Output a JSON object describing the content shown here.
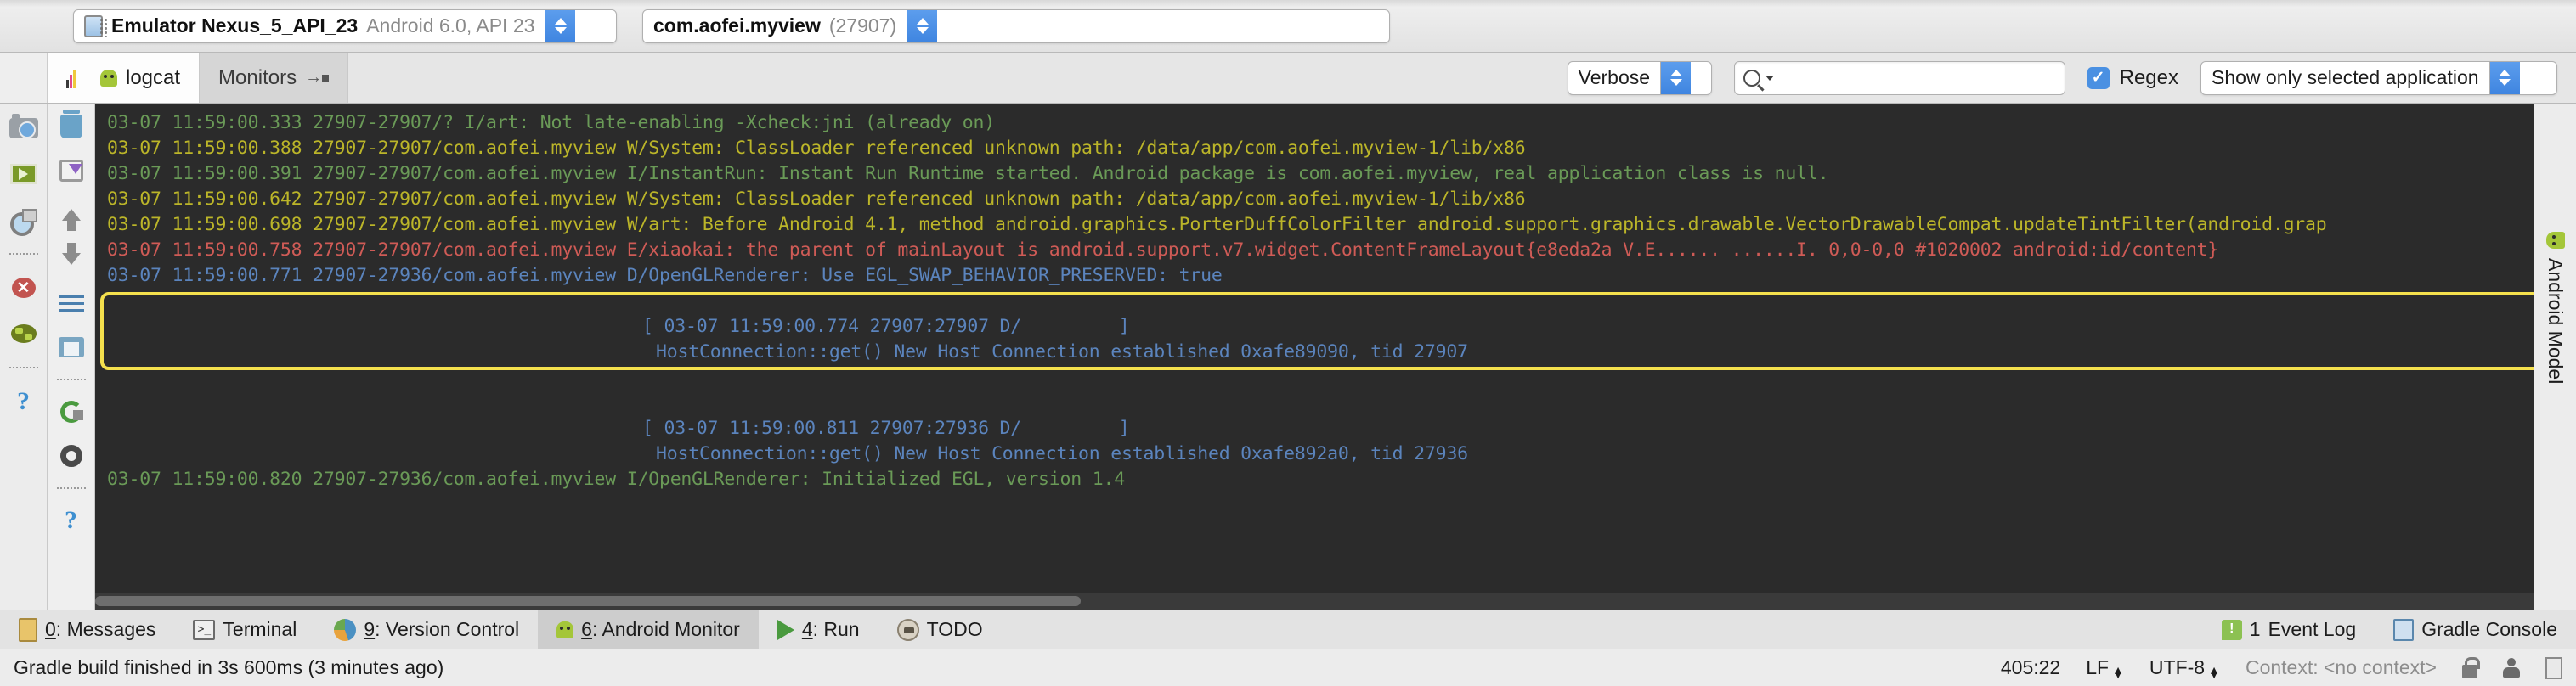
{
  "device_bar": {
    "device_combo": {
      "name": "Emulator Nexus_5_API_23",
      "detail": "Android 6.0, API 23"
    },
    "process_combo": {
      "package": "com.aofei.myview",
      "pid": "(27907)"
    }
  },
  "tabs": [
    {
      "label": "logcat",
      "icon": "logcat-icon",
      "active": true
    },
    {
      "label": "Monitors",
      "icon": "monitors-icon",
      "active": false
    }
  ],
  "log_toolbar": {
    "level": "Verbose",
    "search_placeholder": "",
    "search_value": "",
    "regex_label": "Regex",
    "regex_checked": true,
    "filter": "Show only selected application"
  },
  "sidebar_icons": [
    {
      "name": "screenshot-icon"
    },
    {
      "name": "screen-record-icon"
    },
    {
      "name": "layout-inspector-icon"
    },
    {
      "name": "separator"
    },
    {
      "name": "terminate-application-icon"
    },
    {
      "name": "system-information-icon"
    },
    {
      "name": "separator"
    },
    {
      "name": "help-icon"
    }
  ],
  "log_toolbar_icons": [
    {
      "name": "clear-logcat-icon"
    },
    {
      "name": "scroll-to-end-icon"
    },
    {
      "name": "up-the-stack-trace-icon"
    },
    {
      "name": "down-the-stack-trace-icon"
    },
    {
      "name": "soft-wraps-icon"
    },
    {
      "name": "print-icon"
    },
    {
      "name": "separator"
    },
    {
      "name": "restart-icon"
    },
    {
      "name": "logcat-settings-icon"
    },
    {
      "name": "separator"
    },
    {
      "name": "help-icon"
    }
  ],
  "console": {
    "highlight_color": "#f4e04d",
    "lines": [
      {
        "text": "03-07 11:59:00.333 27907-27907/? I/art: Not late-enabling -Xcheck:jni (already on)",
        "color": "green",
        "indent": 0
      },
      {
        "text": "03-07 11:59:00.388 27907-27907/com.aofei.myview W/System: ClassLoader referenced unknown path: /data/app/com.aofei.myview-1/lib/x86",
        "color": "yellow",
        "indent": 0
      },
      {
        "text": "03-07 11:59:00.391 27907-27907/com.aofei.myview I/InstantRun: Instant Run Runtime started. Android package is com.aofei.myview, real application class is null.",
        "color": "green",
        "indent": 0
      },
      {
        "text": "03-07 11:59:00.642 27907-27907/com.aofei.myview W/System: ClassLoader referenced unknown path: /data/app/com.aofei.myview-1/lib/x86",
        "color": "yellow",
        "indent": 0
      },
      {
        "text": "03-07 11:59:00.698 27907-27907/com.aofei.myview W/art: Before Android 4.1, method android.graphics.PorterDuffColorFilter android.support.graphics.drawable.VectorDrawableCompat.updateTintFilter(android.grap",
        "color": "yellow",
        "indent": 0
      },
      {
        "text": "03-07 11:59:00.758 27907-27907/com.aofei.myview E/xiaokai: the parent of mainLayout is android.support.v7.widget.ContentFrameLayout{e8eda2a V.E...... ......I. 0,0-0,0 #1020002 android:id/content}",
        "color": "red",
        "indent": 0
      },
      {
        "text": "03-07 11:59:00.771 27907-27936/com.aofei.myview D/OpenGLRenderer: Use EGL_SWAP_BEHAVIOR_PRESERVED: true",
        "color": "blue",
        "indent": 0
      },
      {
        "text": "",
        "color": "blue",
        "indent": 0
      },
      {
        "text": "[ 03-07 11:59:00.774 27907:27907 D/         ]",
        "color": "blue",
        "indent": 2
      },
      {
        "text": "HostConnection::get() New Host Connection established 0xafe89090, tid 27907",
        "color": "blue",
        "indent": 1
      },
      {
        "text": "",
        "color": "blue",
        "indent": 0
      },
      {
        "text": "",
        "color": "blue",
        "indent": 0
      },
      {
        "text": "[ 03-07 11:59:00.811 27907:27936 D/         ]",
        "color": "blue",
        "indent": 2
      },
      {
        "text": "HostConnection::get() New Host Connection established 0xafe892a0, tid 27936",
        "color": "blue",
        "indent": 1
      },
      {
        "text": "03-07 11:59:00.820 27907-27936/com.aofei.myview I/OpenGLRenderer: Initialized EGL, version 1.4",
        "color": "green",
        "indent": 0
      }
    ]
  },
  "right_bar": {
    "label": "Android Model"
  },
  "tool_window_bar": {
    "items": [
      {
        "key": "0",
        "label": ": Messages",
        "icon": "messages-icon",
        "selected": false
      },
      {
        "key": "",
        "label": "Terminal",
        "icon": "terminal-icon",
        "selected": false
      },
      {
        "key": "9",
        "label": ": Version Control",
        "icon": "version-control-icon",
        "selected": false
      },
      {
        "key": "6",
        "label": ": Android Monitor",
        "icon": "android-monitor-icon",
        "selected": true
      },
      {
        "key": "4",
        "label": ": Run",
        "icon": "run-icon",
        "selected": false
      },
      {
        "key": "",
        "label": "TODO",
        "icon": "todo-icon",
        "selected": false
      }
    ],
    "right_items": [
      {
        "label": "Event Log",
        "badge": "1",
        "icon": "event-log-icon"
      },
      {
        "label": "Gradle Console",
        "badge": "",
        "icon": "gradle-console-icon"
      }
    ]
  },
  "status_bar": {
    "message": "Gradle build finished in 3s 600ms (3 minutes ago)",
    "caret": "405:22",
    "line_sep": "LF",
    "encoding": "UTF-8",
    "context": "Context: <no context>",
    "icons": [
      "lock-icon",
      "person-icon",
      "memory-icon"
    ]
  }
}
